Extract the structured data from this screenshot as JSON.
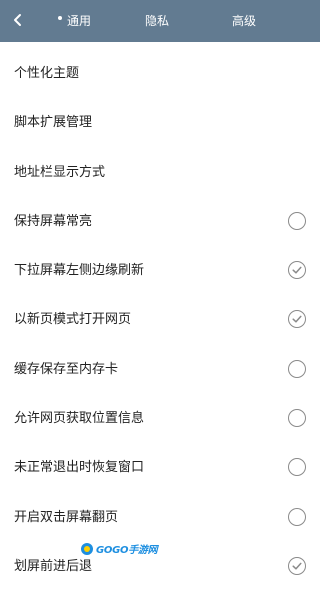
{
  "header": {
    "back_icon": "chevron-left-icon",
    "tabs": [
      {
        "label": "通用",
        "active": true
      },
      {
        "label": "隐私",
        "active": false
      },
      {
        "label": "高级",
        "active": false
      }
    ],
    "color": "#627b91"
  },
  "settings": [
    {
      "label": "个性化主题",
      "toggle": null
    },
    {
      "label": "脚本扩展管理",
      "toggle": null
    },
    {
      "label": "地址栏显示方式",
      "toggle": null
    },
    {
      "label": "保持屏幕常亮",
      "toggle": false
    },
    {
      "label": "下拉屏幕左侧边缘刷新",
      "toggle": true
    },
    {
      "label": "以新页模式打开网页",
      "toggle": true
    },
    {
      "label": "缓存保存至内存卡",
      "toggle": false
    },
    {
      "label": "允许网页获取位置信息",
      "toggle": false
    },
    {
      "label": "未正常退出时恢复窗口",
      "toggle": false
    },
    {
      "label": "开启双击屏幕翻页",
      "toggle": false
    },
    {
      "label": "划屏前进后退",
      "toggle": true
    }
  ],
  "watermark": {
    "text": "GOGO手游网"
  }
}
